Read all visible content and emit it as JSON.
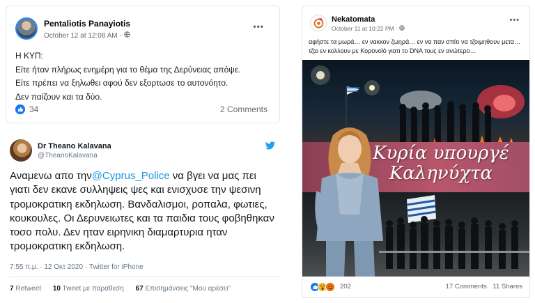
{
  "fb_post_1": {
    "author": "Pentaliotis Panayiotis",
    "timestamp": "October 12 at 12:08 AM",
    "audience_icon": "globe-icon",
    "more_label": "•••",
    "lines": [
      "Η ΚΥΠ:",
      "Είτε ήταν πλήρως  ενημέρη για το θέμα της Δερύνειας απόψε.",
      "Είτε πρέπει να ξηλωθει αφού δεν εξορτωσε το αυτονόητο.",
      "Δεν παίζουν και τα δύο."
    ],
    "reaction_icon": "like-icon",
    "reaction_count": "34",
    "comments": "2 Comments"
  },
  "tweet": {
    "author": "Dr Theano Kalavana",
    "handle": "@TheanoKalavana",
    "logo_icon": "twitter-bird-icon",
    "text_before": "Αναμενω απο την",
    "mention": "@Cyprus_Police",
    "text_after": " να βγει να μας πει γιατι δεν εκανε συλληψεις ψες και ενισχυσε την ψεσινη τρομοκρατικη εκδηλωση. Βανδαλισμοι, ροπαλα, φωτιες, κουκουλες. Οι Δερυνειωτες και τα παιδια τους φοβηθηκαν τοσο πολυ. Δεν ηταν ειρηνικη διαμαρτυρια ηταν τρομοκρατικη εκδηλωση.",
    "time": "7:55 π.μ. · 12 Οκτ 2020 · Twitter for iPhone",
    "retweets_count": "7",
    "retweets_label": "Retweet",
    "quotes_count": "10",
    "quotes_label": "Tweet με παράθεση",
    "likes_count": "67",
    "likes_label": "Επισημάνσεις \"Μου αρέσει\""
  },
  "fb_post_2": {
    "author": "Nekatomata",
    "timestamp": "October 11 at 10:22 PM",
    "audience_icon": "globe-icon",
    "more_label": "•••",
    "text": "αφήστε τα μωρά… εν νακκον ζωηρά… εν να παν σπίτι να τζοιμηθουν μετα… τζαι εν κολλουν με Κορονοϊό γιατι το DNA τους εν ανώτερο…",
    "photo_caption_line1": "Κυρία υπουργέ",
    "photo_caption_line2": "Καληνύχτα",
    "reaction_count": "202",
    "comments": "17 Comments",
    "shares": "11 Shares"
  }
}
